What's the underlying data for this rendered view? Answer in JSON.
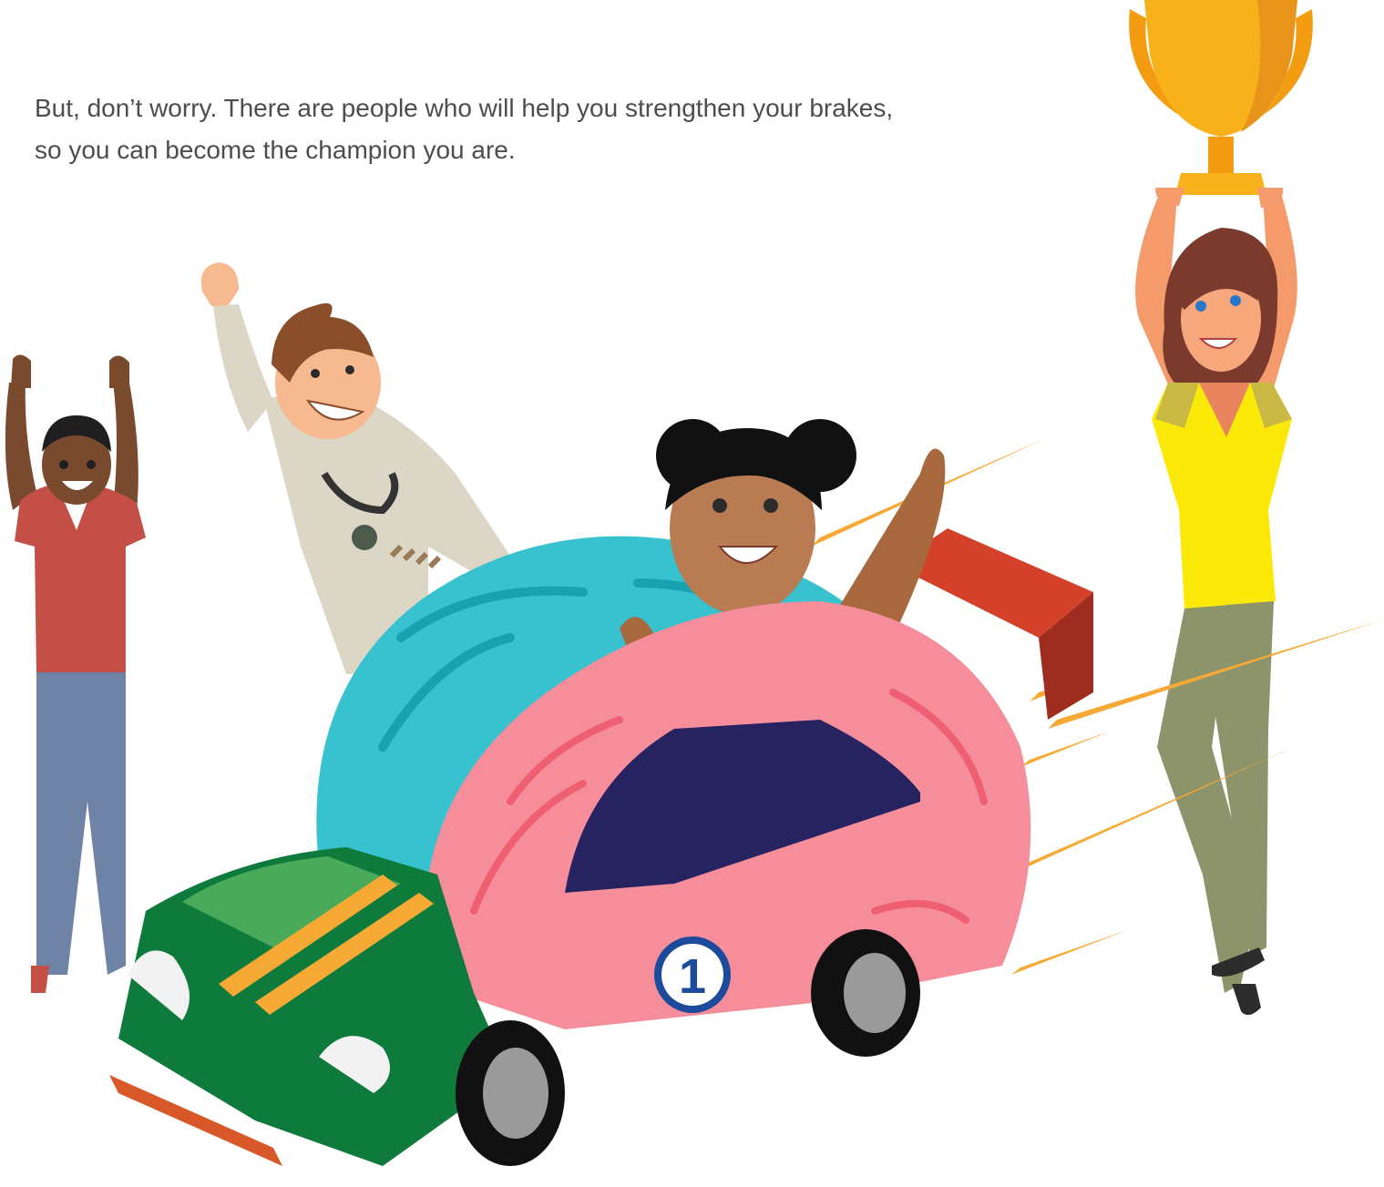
{
  "caption": {
    "line1": "But, don’t worry. There are people who will help you strengthen your brakes,",
    "line2": "so you can become the champion you are."
  },
  "car": {
    "number": "1"
  },
  "colors": {
    "text": "#4d4d4d",
    "brain_blue": "#38c1cf",
    "brain_pink": "#f58d9b",
    "car_green": "#0e7a3b",
    "stripe_orange": "#f6a934",
    "trophy_gold": "#f7b21b"
  }
}
